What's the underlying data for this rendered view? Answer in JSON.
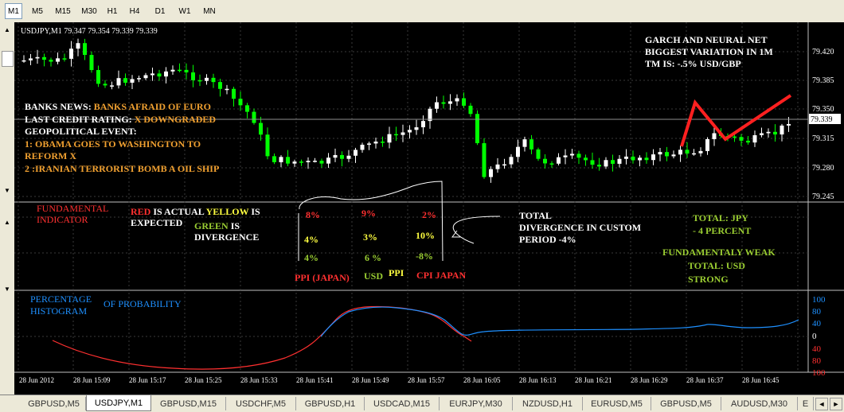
{
  "toolbar": {
    "timeframes": [
      "M1",
      "M5",
      "M15",
      "M30",
      "H1",
      "H4",
      "D1",
      "W1",
      "MN"
    ],
    "active": "M1"
  },
  "price_chart": {
    "header": "USDJPY,M1  79.347 79.354 79.339 79.339",
    "price_labels": [
      "79.420",
      "79.385",
      "79.350",
      "79.315",
      "79.280",
      "79.245"
    ],
    "current_price": "79.339",
    "garch_note": [
      "GARCH AND NEURAL NET",
      "BIGGEST VARIATION IN 1M",
      "TM IS: -.5% USD/GBP"
    ],
    "news": {
      "banks_label": "BANKS NEWS: ",
      "banks_value": "BANKS AFRAID OF EURO",
      "credit_label": "LAST CREDIT RATING: ",
      "credit_value": "X DOWNGRADED",
      "geo_label": "GEOPOLITICAL EVENT:",
      "event1a": "1: OBAMA GOES TO WASHINGTON TO",
      "event1b": "REFORM X",
      "event2": "2 :IRANIAN TERRORIST BOMB A OIL SHIP"
    }
  },
  "fundamental_panel": {
    "title_a": "FUNDAMENTAL",
    "title_b": "INDICATOR",
    "legend_red": "RED",
    "legend_is_actual": " IS ACTUAL ",
    "legend_yellow": "YELLOW",
    "legend_is": " IS",
    "legend_expected": "EXPECTED",
    "legend_green": "GREEN",
    "legend_green_is": " IS",
    "legend_divergence": "DIVERGENCE",
    "col1": {
      "actual": "8%",
      "expected": "4%",
      "divergence": "4%",
      "label": "PPI (JAPAN)"
    },
    "col2": {
      "actual": "9%",
      "expected": "3%",
      "divergence": "6  %",
      "label_a": "USD",
      "label_b": "PPI"
    },
    "col3": {
      "actual": "2%",
      "expected": "10%",
      "divergence": "-8%",
      "label": "CPI JAPAN"
    },
    "total_div_a": "TOTAL",
    "total_div_b": "DIVERGENCE IN  CUSTOM",
    "total_div_c": "PERIOD -4%",
    "total_jpy_a": "TOTAL:  JPY",
    "total_jpy_b": "- 4 PERCENT",
    "weak": "FUNDAMENTALY WEAK",
    "total_usd": "TOTAL: USD",
    "strong": "STRONG"
  },
  "histogram_panel": {
    "title_a": "PERCENTAGE",
    "title_b": "HISTOGRAM",
    "title_c": "OF PROBABILITY",
    "scale": [
      "100",
      "80",
      "40",
      "0",
      "40",
      "80",
      "100"
    ]
  },
  "time_axis": [
    "28 Jun 2012",
    "28 Jun 15:09",
    "28 Jun 15:17",
    "28 Jun 15:25",
    "28 Jun 15:33",
    "28 Jun 15:41",
    "28 Jun 15:49",
    "28 Jun 15:57",
    "28 Jun 16:05",
    "28 Jun 16:13",
    "28 Jun 16:21",
    "28 Jun 16:29",
    "28 Jun 16:37",
    "28 Jun 16:45"
  ],
  "bottom_tabs": [
    "GBPUSD,M5",
    "USDJPY,M1",
    "GBPUSD,M15",
    "USDCHF,M5",
    "GBPUSD,H1",
    "USDCAD,M15",
    "EURJPY,M30",
    "NZDUSD,H1",
    "EURUSD,M5",
    "GBPUSD,M5",
    "AUDUSD,M30",
    "E"
  ],
  "active_tab": "USDJPY,M1",
  "colors": {
    "up": "#ffffff",
    "down": "#00ff00",
    "grid": "#3a3a3a",
    "price_line": "#aaaaaa",
    "red": "#ff3030",
    "yellow": "#ffff40",
    "green": "#9acd32",
    "blue": "#1e90ff",
    "orange": "#f0a030"
  }
}
